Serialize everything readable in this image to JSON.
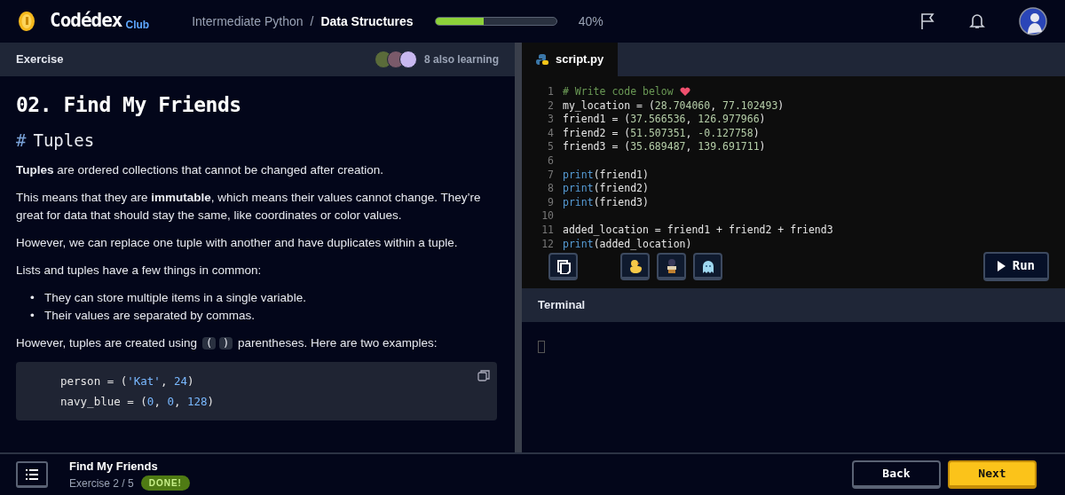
{
  "header": {
    "logo": "Codédex",
    "logo_badge": "Club",
    "breadcrumb": [
      {
        "text": "Intermediate Python",
        "current": false
      },
      {
        "text": "Data Structures",
        "current": true
      }
    ],
    "separator": "/",
    "progress": {
      "level": 0.4,
      "reading": "40%"
    }
  },
  "exercise_panel": {
    "tab": "Exercise",
    "learners": {
      "text": "8 also learning"
    },
    "title": "02. Find My Friends",
    "section": {
      "marker": "#",
      "title": "Tuples"
    },
    "blocks": [
      {
        "kind": "paragraph",
        "text": "**Tuples** are ordered collections that cannot be changed after creation."
      },
      {
        "kind": "paragraph",
        "text": "This means that they are **immutable**, which means their values cannot change. They’re great for data that should stay the same, like coordinates or color values."
      },
      {
        "kind": "paragraph",
        "text": "However, we can replace one tuple with another and have duplicates within a tuple."
      },
      {
        "kind": "paragraph",
        "text": "Lists and tuples have a few things in common:"
      },
      {
        "kind": "list",
        "items": [
          {
            "marker": "•",
            "text": "They can store multiple items in a single variable."
          },
          {
            "marker": "•",
            "text": "Their values are separated by commas."
          }
        ]
      },
      {
        "kind": "parts",
        "parts": [
          {
            "kind": "text",
            "text": "However, tuples are created using "
          },
          {
            "kind": "code",
            "text": "("
          },
          {
            "kind": "code",
            "text": ")"
          },
          {
            "kind": "text",
            "text": " parentheses. Here are two examples:"
          }
        ]
      },
      {
        "kind": "code",
        "lines": [
          [
            {
              "kind": "plain",
              "text": "person = ("
            },
            {
              "kind": "string",
              "text": "'Kat'"
            },
            {
              "kind": "plain",
              "text": ", "
            },
            {
              "kind": "number",
              "text": "24"
            },
            {
              "kind": "plain",
              "text": ")"
            }
          ],
          [
            {
              "kind": "plain",
              "text": "navy_blue = ("
            },
            {
              "kind": "number",
              "text": "0"
            },
            {
              "kind": "plain",
              "text": ", "
            },
            {
              "kind": "number",
              "text": "0"
            },
            {
              "kind": "plain",
              "text": ", "
            },
            {
              "kind": "number",
              "text": "128"
            },
            {
              "kind": "plain",
              "text": ")"
            }
          ]
        ]
      }
    ]
  },
  "editor": {
    "file_tab": "script.py",
    "lines": [
      {
        "number": "1",
        "tokens": [
          {
            "kind": "comment",
            "text": "# Write code below"
          }
        ],
        "heart": true
      },
      {
        "number": "2",
        "tokens": [
          {
            "kind": "plain",
            "text": "my_location = ("
          },
          {
            "kind": "number",
            "text": "28.704060"
          },
          {
            "kind": "plain",
            "text": ", "
          },
          {
            "kind": "number",
            "text": "77.102493"
          },
          {
            "kind": "plain",
            "text": ")"
          }
        ]
      },
      {
        "number": "3",
        "tokens": [
          {
            "kind": "plain",
            "text": "friend1 = ("
          },
          {
            "kind": "number",
            "text": "37.566536"
          },
          {
            "kind": "plain",
            "text": ", "
          },
          {
            "kind": "number",
            "text": "126.977966"
          },
          {
            "kind": "plain",
            "text": ")"
          }
        ]
      },
      {
        "number": "4",
        "tokens": [
          {
            "kind": "plain",
            "text": "friend2 = ("
          },
          {
            "kind": "number",
            "text": "51.507351"
          },
          {
            "kind": "plain",
            "text": ", "
          },
          {
            "kind": "number",
            "text": "-0.127758"
          },
          {
            "kind": "plain",
            "text": ")"
          }
        ]
      },
      {
        "number": "5",
        "tokens": [
          {
            "kind": "plain",
            "text": "friend3 = ("
          },
          {
            "kind": "number",
            "text": "35.689487"
          },
          {
            "kind": "plain",
            "text": ", "
          },
          {
            "kind": "number",
            "text": "139.691711"
          },
          {
            "kind": "plain",
            "text": ")"
          }
        ]
      },
      {
        "number": "6"
      },
      {
        "number": "7",
        "tokens": [
          {
            "kind": "function",
            "text": "print"
          },
          {
            "kind": "plain",
            "text": "(friend1)"
          }
        ]
      },
      {
        "number": "8",
        "tokens": [
          {
            "kind": "function",
            "text": "print"
          },
          {
            "kind": "plain",
            "text": "(friend2)"
          }
        ]
      },
      {
        "number": "9",
        "tokens": [
          {
            "kind": "function",
            "text": "print"
          },
          {
            "kind": "plain",
            "text": "(friend3)"
          }
        ]
      },
      {
        "number": "10"
      },
      {
        "number": "11",
        "tokens": [
          {
            "kind": "plain",
            "text": "added_location = friend1 + friend2 + friend3"
          }
        ]
      },
      {
        "number": "12",
        "tokens": [
          {
            "kind": "function",
            "text": "print"
          },
          {
            "kind": "plain",
            "text": "(added_location)"
          }
        ]
      }
    ],
    "tools": [
      {
        "kind": "copy"
      },
      {
        "kind": "duck"
      },
      {
        "kind": "figure"
      },
      {
        "kind": "ghost"
      }
    ],
    "run_button": "Run"
  },
  "terminal": {
    "title": "Terminal",
    "cursor": true
  },
  "footer": {
    "title": "Find My Friends",
    "subtitle": "Exercise 2 / 5",
    "status": "DONE!",
    "buttons": [
      {
        "label": "Back",
        "primary": false
      },
      {
        "label": "Next",
        "primary": true
      }
    ]
  }
}
